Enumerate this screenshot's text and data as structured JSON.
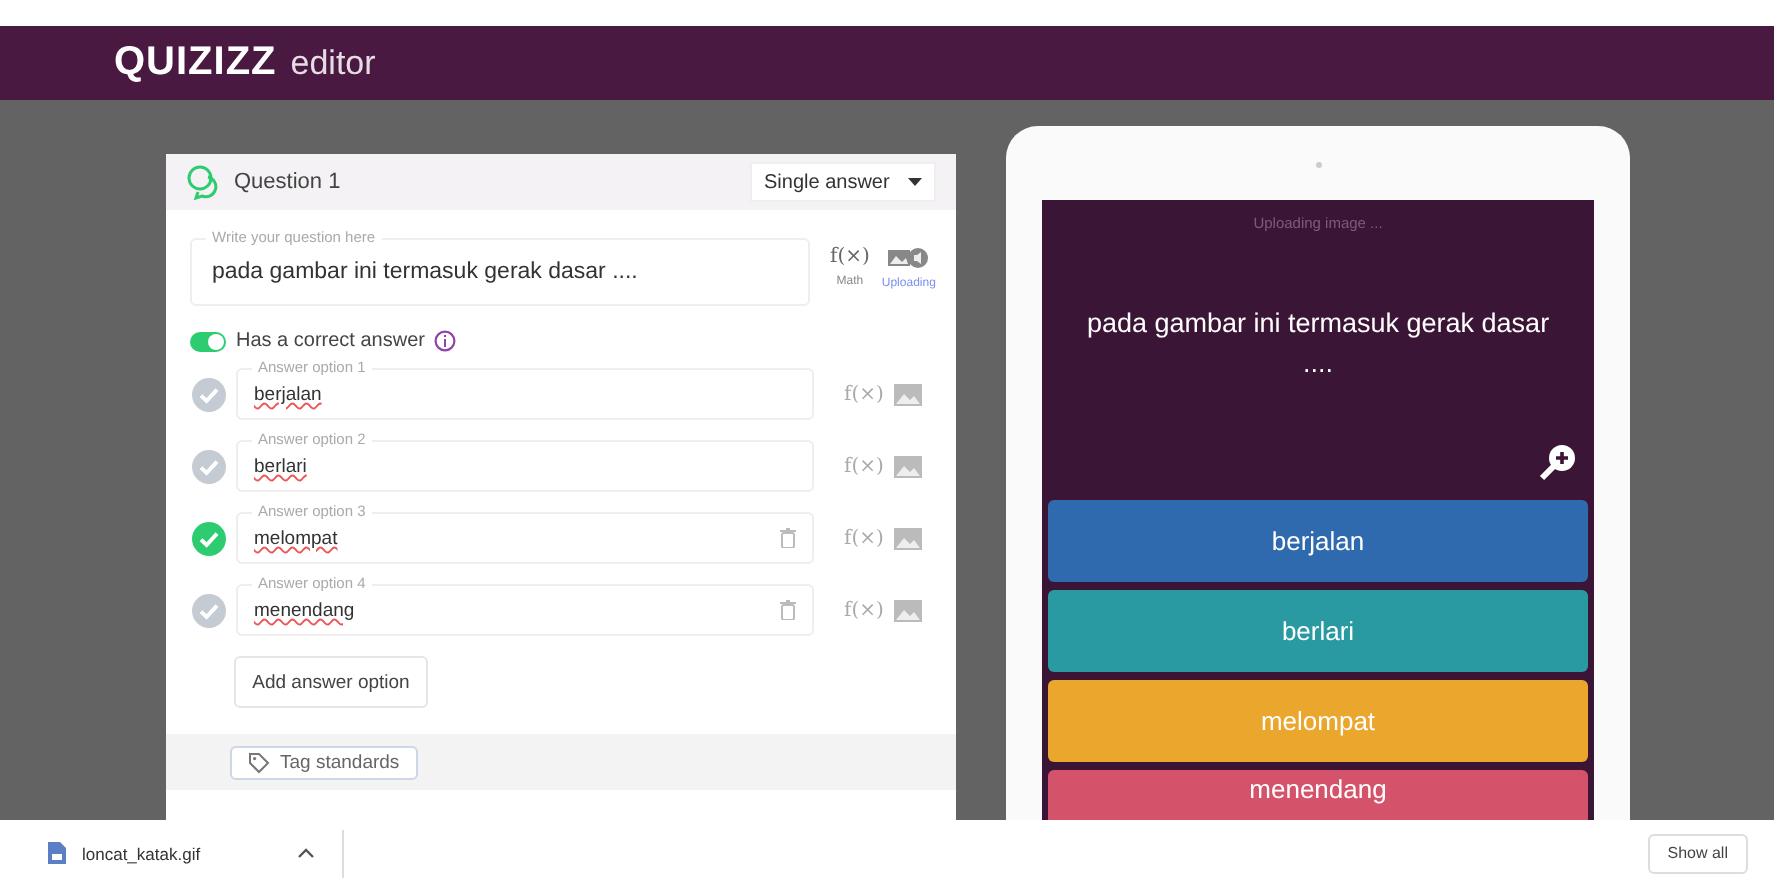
{
  "header": {
    "logo": "QUIZIZZ",
    "title": "editor"
  },
  "editor": {
    "question_title": "Question 1",
    "answer_type": "Single answer",
    "question_field": {
      "label": "Write your question here",
      "value": "pada gambar ini termasuk gerak dasar ...."
    },
    "math_symbol": "f(×)",
    "math_label": "Math",
    "upload_label": "Uploading",
    "correct_toggle": {
      "label": "Has a correct answer",
      "on": true
    },
    "options": [
      {
        "label": "Answer option 1",
        "value": "berjalan",
        "correct": false,
        "deletable": false,
        "math_symbol": "f(×)"
      },
      {
        "label": "Answer option 2",
        "value": "berlari",
        "correct": false,
        "deletable": false,
        "math_symbol": "f(×)"
      },
      {
        "label": "Answer option 3",
        "value": "melompat",
        "correct": true,
        "deletable": true,
        "math_symbol": "f(×)"
      },
      {
        "label": "Answer option 4",
        "value": "menendang",
        "correct": false,
        "deletable": true,
        "math_symbol": "f(×)"
      }
    ],
    "add_option": "Add answer option",
    "tag_standards": "Tag standards"
  },
  "preview": {
    "status": "Uploading image ...",
    "question": "pada gambar ini termasuk gerak dasar ....",
    "answers": [
      {
        "text": "berjalan",
        "color": "#2f6aae"
      },
      {
        "text": "berlari",
        "color": "#2a9aa2"
      },
      {
        "text": "melompat",
        "color": "#eba62e"
      },
      {
        "text": "menendang",
        "color": "#d5536a"
      }
    ]
  },
  "download_bar": {
    "file": "loncat_katak.gif",
    "show_all": "Show all"
  }
}
